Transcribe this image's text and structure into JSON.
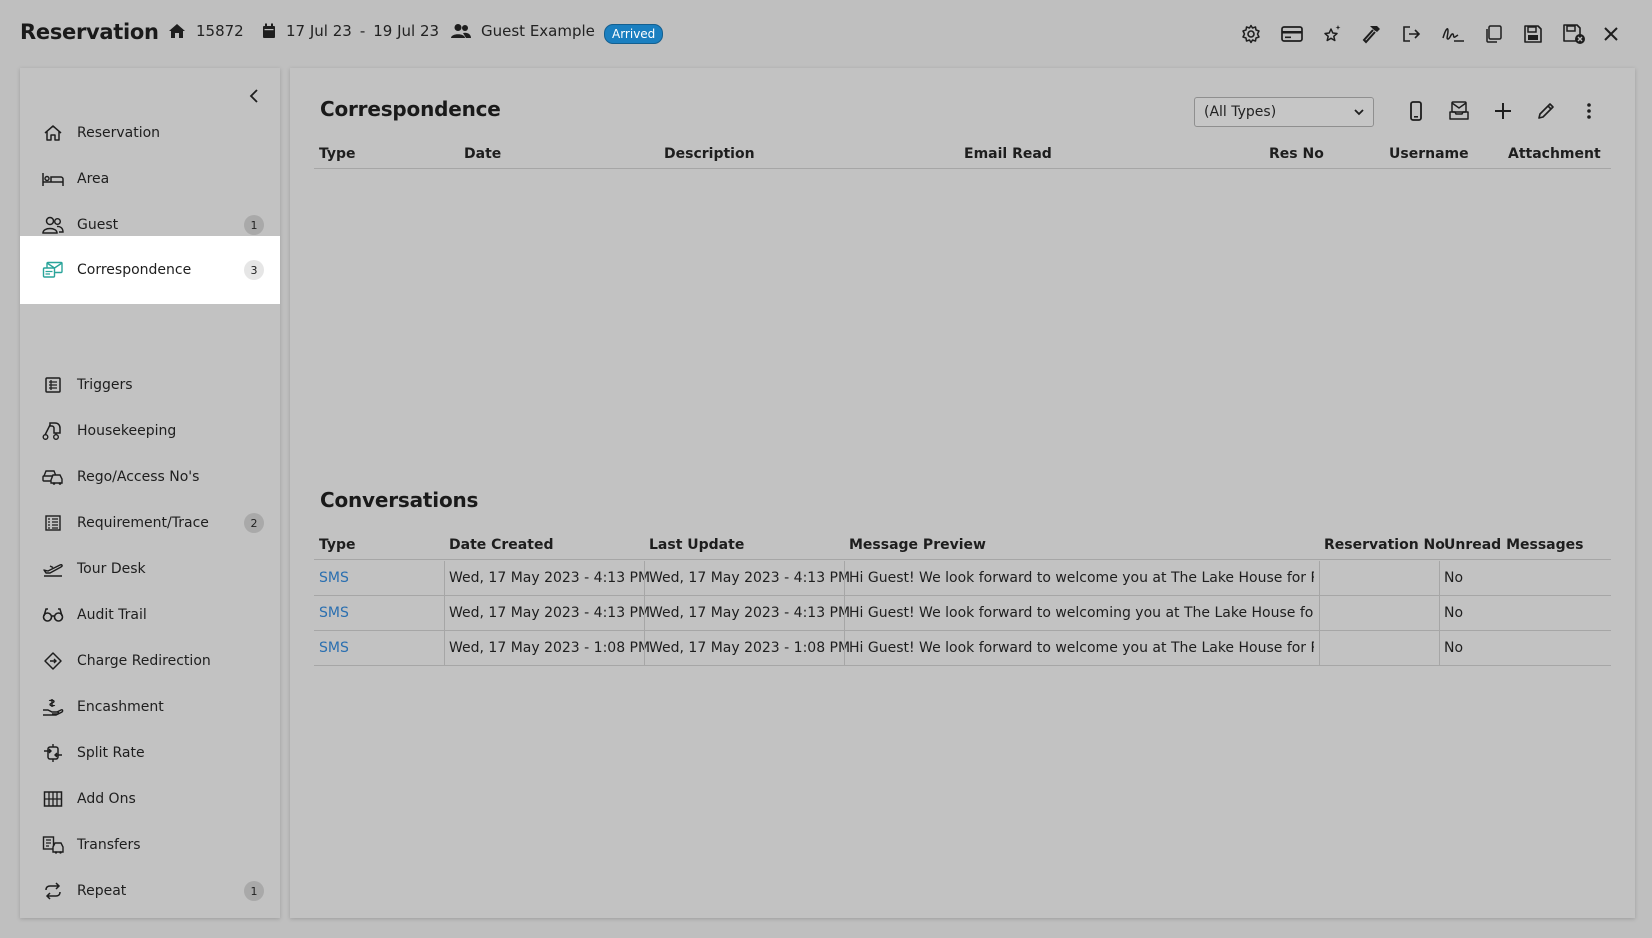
{
  "header": {
    "title": "Reservation",
    "property_no": "15872",
    "date_from": "17 Jul 23",
    "date_sep": "-",
    "date_to": "19 Jul 23",
    "guest_name": "Guest Example",
    "status": "Arrived"
  },
  "toolbar_icons": [
    "gear-icon",
    "credit-card-icon",
    "sparkle-star-icon",
    "hammer-icon",
    "check-out-icon",
    "signature-icon",
    "copy-icon",
    "save-icon",
    "save-close-icon",
    "close-icon"
  ],
  "sidebar": {
    "items": [
      {
        "label": "Reservation",
        "icon": "home-icon",
        "count": ""
      },
      {
        "label": "Area",
        "icon": "bed-icon",
        "count": ""
      },
      {
        "label": "Guest",
        "icon": "people-icon",
        "count": "1"
      },
      {
        "label": "Correspondence",
        "icon": "envelopes-icon",
        "count": "3",
        "active": true
      },
      {
        "label": "Triggers",
        "icon": "triggers-icon",
        "count": ""
      },
      {
        "label": "Housekeeping",
        "icon": "vacuum-icon",
        "count": ""
      },
      {
        "label": "Rego/Access No's",
        "icon": "car-icon",
        "count": ""
      },
      {
        "label": "Requirement/Trace",
        "icon": "list-icon",
        "count": "2"
      },
      {
        "label": "Tour Desk",
        "icon": "plane-icon",
        "count": ""
      },
      {
        "label": "Audit Trail",
        "icon": "glasses-icon",
        "count": ""
      },
      {
        "label": "Charge Redirection",
        "icon": "diamond-icon",
        "count": ""
      },
      {
        "label": "Encashment",
        "icon": "hand-coin-icon",
        "count": ""
      },
      {
        "label": "Split Rate",
        "icon": "split-icon",
        "count": ""
      },
      {
        "label": "Add Ons",
        "icon": "grid-icon",
        "count": ""
      },
      {
        "label": "Transfers",
        "icon": "transfer-icon",
        "count": ""
      },
      {
        "label": "Repeat",
        "icon": "repeat-icon",
        "count": "1"
      }
    ]
  },
  "correspondence": {
    "title": "Correspondence",
    "filter_value": "(All Types)",
    "columns": [
      "Type",
      "Date",
      "Description",
      "Email Read",
      "Res No",
      "Username",
      "Attachment"
    ]
  },
  "conversations": {
    "title": "Conversations",
    "columns": [
      "Type",
      "Date Created",
      "Last Update",
      "Message Preview",
      "Reservation No",
      "Unread Messages"
    ],
    "rows": [
      {
        "type": "SMS",
        "created": "Wed, 17 May 2023 - 4:13 PM",
        "updated": "Wed, 17 May 2023 - 4:13 PM",
        "preview": "Hi Guest! We look forward to welcome you at The Lake House for Res...",
        "res_no": "",
        "unread": "No"
      },
      {
        "type": "SMS",
        "created": "Wed, 17 May 2023 - 4:13 PM",
        "updated": "Wed, 17 May 2023 - 4:13 PM",
        "preview": "Hi Guest! We look forward to welcoming you at The Lake House for R...",
        "res_no": "",
        "unread": "No"
      },
      {
        "type": "SMS",
        "created": "Wed, 17 May 2023 - 1:08 PM",
        "updated": "Wed, 17 May 2023 - 1:08 PM",
        "preview": "Hi Guest! We look forward to welcome you at The Lake House for Res...",
        "res_no": "",
        "unread": "No"
      }
    ]
  }
}
